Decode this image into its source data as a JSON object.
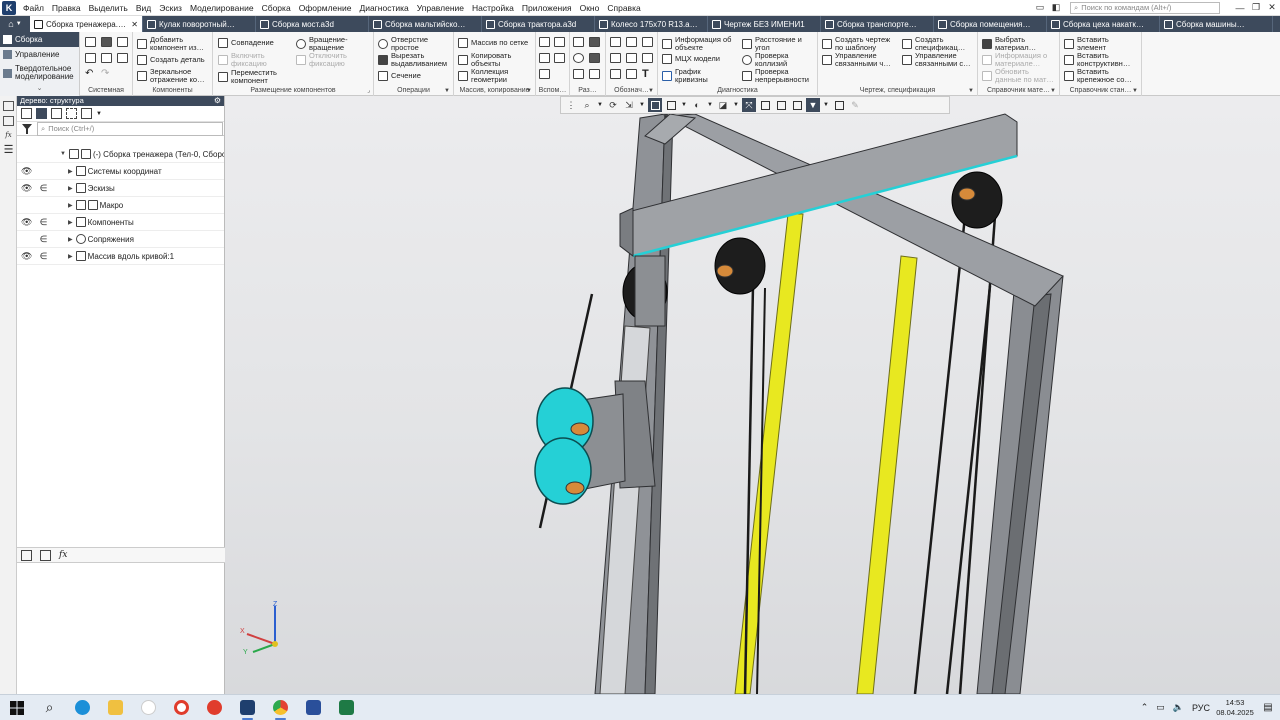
{
  "menu": {
    "items": [
      "Файл",
      "Правка",
      "Выделить",
      "Вид",
      "Эскиз",
      "Моделирование",
      "Сборка",
      "Оформление",
      "Диагностика",
      "Управление",
      "Настройка",
      "Приложения",
      "Окно",
      "Справка"
    ],
    "search_placeholder": "Поиск по командам (Alt+/)"
  },
  "tabs": [
    {
      "label": "Сборка тренажера.a…",
      "active": true
    },
    {
      "label": "Кулак поворотный…"
    },
    {
      "label": "Сборка мост.a3d"
    },
    {
      "label": "Сборка мальтийско…"
    },
    {
      "label": "Сборка трактора.a3d"
    },
    {
      "label": "Колесо 175x70 R13.a…"
    },
    {
      "label": "Чертеж БЕЗ ИМЕНИ1"
    },
    {
      "label": "Сборка транспорте…"
    },
    {
      "label": "Сборка помещения…"
    },
    {
      "label": "Сборка цеха накатк…"
    },
    {
      "label": "Сборка машины…"
    }
  ],
  "ribbon": {
    "left_items": [
      "Сборка",
      "Управление",
      "Твердотельное моделирование"
    ],
    "groups": {
      "system": "Системная",
      "components": "Компоненты",
      "placement": "Размещение компонентов",
      "operations": "Операции",
      "array": "Массив, копирование",
      "aux": "Вспом…",
      "dims": "Раз…",
      "notation": "Обознач…",
      "diagnostics": "Диагностика",
      "drawing": "Чертеж, спецификация",
      "ref_materials": "Справочник мате…",
      "ref_standard": "Справочник стан…"
    },
    "commands": {
      "add_component": "Добавить компонент из…",
      "create_part": "Создать деталь",
      "mirror_component": "Зеркальное отражение ко…",
      "coincidence": "Совпадение",
      "enable_fix": "Включить фиксацию",
      "move_component": "Переместить компонент",
      "move_rotate": "Вращение-вращение",
      "disable_fix": "Отключить фиксацию",
      "hole_simple": "Отверстие простое",
      "cut_extrude": "Вырезать выдавливанием",
      "section": "Сечение",
      "array_grid": "Массив по сетке",
      "copy_objects": "Копировать объекты",
      "geometry_collection": "Коллекция геометрии",
      "object_info": "Информация об объекте",
      "mcc_models": "МЦХ модели",
      "curvature_graph": "График кривизны",
      "distance_angle": "Расстояние и угол",
      "check_collisions": "Проверка коллизий",
      "check_continuity": "Проверка непрерывности",
      "create_drawing": "Создать чертеж по шаблону",
      "manage_linked": "Управление связанными ч…",
      "create_spec": "Создать спецификац…",
      "manage_linked_spec": "Управление связанными с…",
      "choose_material": "Выбрать материал…",
      "material_info": "Информация о материале…",
      "update_material": "Обновить данные по мат…",
      "insert_element": "Вставить элемент",
      "insert_structural": "Вставить конструктивн…",
      "insert_fastener": "Вставить крепежное со…"
    }
  },
  "tree": {
    "header": "Дерево: структура",
    "search_placeholder": "Поиск (Ctrl+/)",
    "rows": [
      {
        "label": "(-) Сборка тренажера (Тел-0, Сборо…",
        "eye": false,
        "sketch": false,
        "expanded": true
      },
      {
        "label": "Системы координат",
        "eye": true,
        "sketch": false
      },
      {
        "label": "Эскизы",
        "eye": true,
        "sketch": true
      },
      {
        "label": "Макро",
        "eye": false,
        "sketch": false
      },
      {
        "label": "Компоненты",
        "eye": true,
        "sketch": true
      },
      {
        "label": "Сопряжения",
        "eye": false,
        "sketch": true
      },
      {
        "label": "Массив вдоль кривой:1",
        "eye": true,
        "sketch": true
      }
    ]
  },
  "axes": {
    "x": "X",
    "y": "Y",
    "z": "Z"
  },
  "tray": {
    "lang": "РУС",
    "time": "14:53",
    "date": "08.04.2025"
  },
  "taskbar_apps": [
    "windows-start",
    "search",
    "edge",
    "file-explorer",
    "chat-app",
    "yandex-browser",
    "yandex-y",
    "kompas-3d",
    "chrome",
    "kompas-manager",
    "excel"
  ],
  "colors": {
    "accent": "#3d4a5c",
    "highlight_cyan": "#25d0d6",
    "yellow_bar": "#e8e820",
    "frame_gray": "#8a8d92"
  }
}
